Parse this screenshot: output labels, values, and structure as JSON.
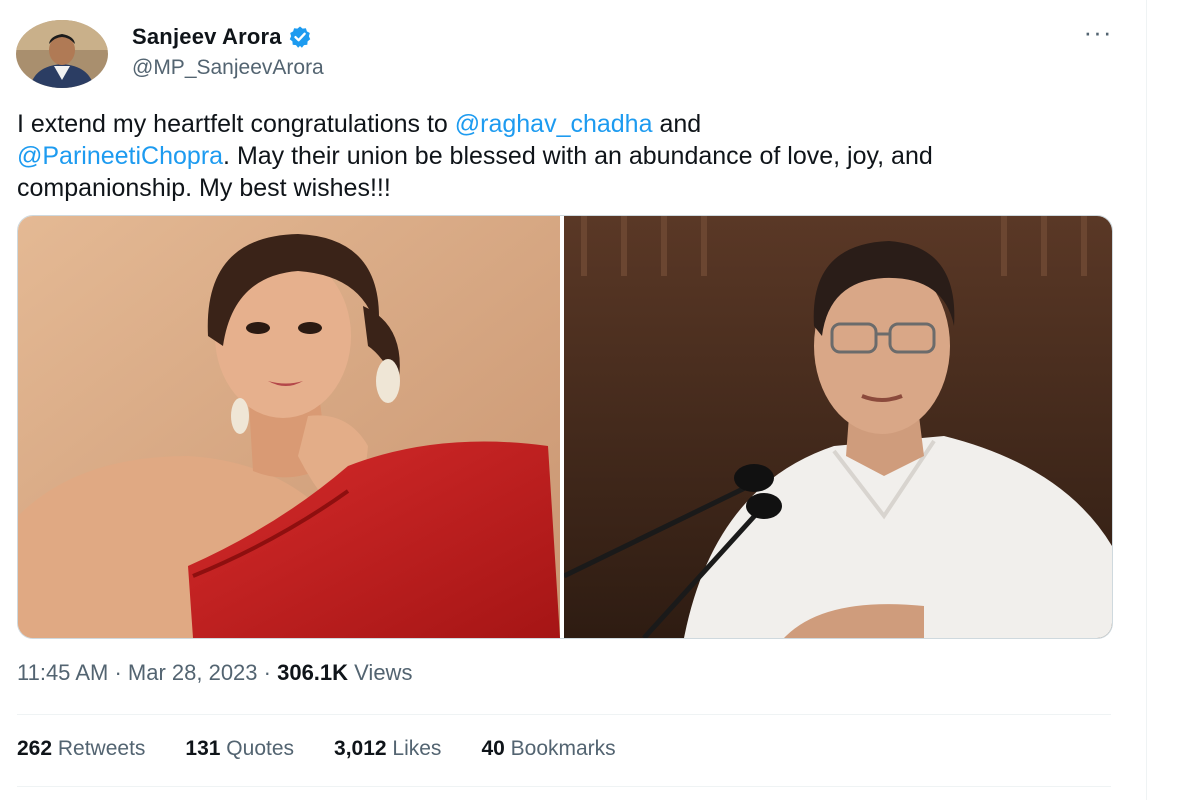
{
  "author": {
    "display_name": "Sanjeev Arora",
    "handle": "@MP_SanjeevArora",
    "verified_color": "#1d9bf0"
  },
  "tweet": {
    "text_part1": "I extend my heartfelt congratulations to ",
    "mention1": "@raghav_chadha",
    "text_part2": " and ",
    "mention2": "@ParineetiChopra",
    "text_part3": ". May their union be blessed with an abundance of love, joy, and companionship. My best wishes!!!"
  },
  "meta": {
    "time": "11:45 AM",
    "separator": " · ",
    "date": "Mar 28, 2023",
    "views_count": "306.1K",
    "views_label": " Views"
  },
  "stats": {
    "retweets_count": "262",
    "retweets_label": " Retweets",
    "quotes_count": "131",
    "quotes_label": " Quotes",
    "likes_count": "3,012",
    "likes_label": " Likes",
    "bookmarks_count": "40",
    "bookmarks_label": " Bookmarks"
  },
  "icons": {
    "more": "more-options-icon",
    "verified": "verified-badge-icon"
  },
  "colors": {
    "accent": "#1d9bf0",
    "secondary_text": "#536471",
    "primary_text": "#0f1419"
  }
}
